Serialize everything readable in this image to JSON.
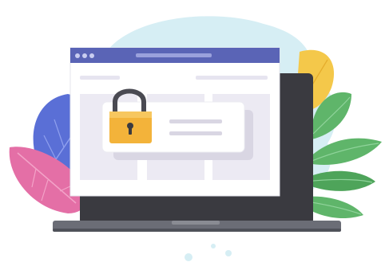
{
  "illustration": {
    "subject": "laptop-with-locked-browser-window",
    "icons": [
      "padlock-icon",
      "leaf-icon"
    ]
  },
  "colors": {
    "blob": "#d6eef4",
    "laptop_body": "#3a3a40",
    "laptop_base": "#6b6d76",
    "window_bar": "#5a64b6",
    "window_bg": "#ffffff",
    "panel": "#e6e4f0",
    "lock_body": "#f3b33a",
    "lock_shackle": "#4a4a52",
    "leaf_green": "#5fb56a",
    "leaf_blue": "#5a6fd6",
    "leaf_pink": "#e46fa6",
    "leaf_yellow": "#f4c84a"
  }
}
